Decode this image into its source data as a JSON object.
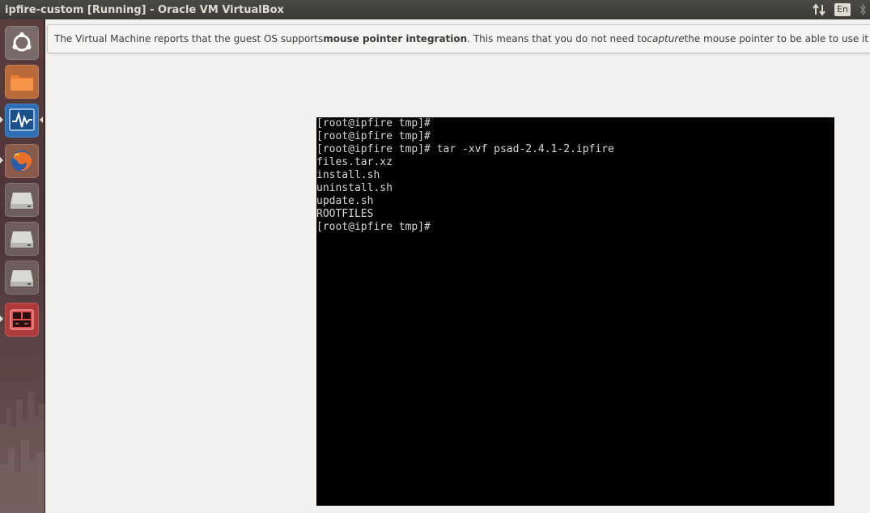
{
  "window": {
    "title": "ipfire-custom [Running] - Oracle VM VirtualBox",
    "keyboard_layout": "En"
  },
  "indicators": {
    "network_icon": "network-updown-icon",
    "bluetooth_icon": "bluetooth-icon"
  },
  "launcher": {
    "items": [
      {
        "name": "ubuntu-dash-icon"
      },
      {
        "name": "files-folder-icon"
      },
      {
        "name": "system-monitor-icon"
      },
      {
        "name": "firefox-icon"
      },
      {
        "name": "drive-icon-1"
      },
      {
        "name": "drive-icon-2"
      },
      {
        "name": "drive-icon-3"
      },
      {
        "name": "virtualbox-vm-icon"
      }
    ]
  },
  "notice": {
    "part1": "The Virtual Machine reports that the guest OS supports ",
    "bold": "mouse pointer integration",
    "part2": ". This means that you do not need to ",
    "italic": "capture",
    "part3": " the mouse pointer to be able to use it in yo"
  },
  "console": {
    "lines": [
      "[root@ipfire tmp]#",
      "[root@ipfire tmp]#",
      "[root@ipfire tmp]# tar -xvf psad-2.4.1-2.ipfire",
      "files.tar.xz",
      "install.sh",
      "uninstall.sh",
      "update.sh",
      "ROOTFILES",
      "[root@ipfire tmp]#"
    ]
  },
  "colors": {
    "topbar": "#3c3b37",
    "launcher": "#4d3537",
    "vm_background": "#f2f1f0",
    "console_bg": "#000000",
    "console_fg": "#d8d8d8"
  }
}
